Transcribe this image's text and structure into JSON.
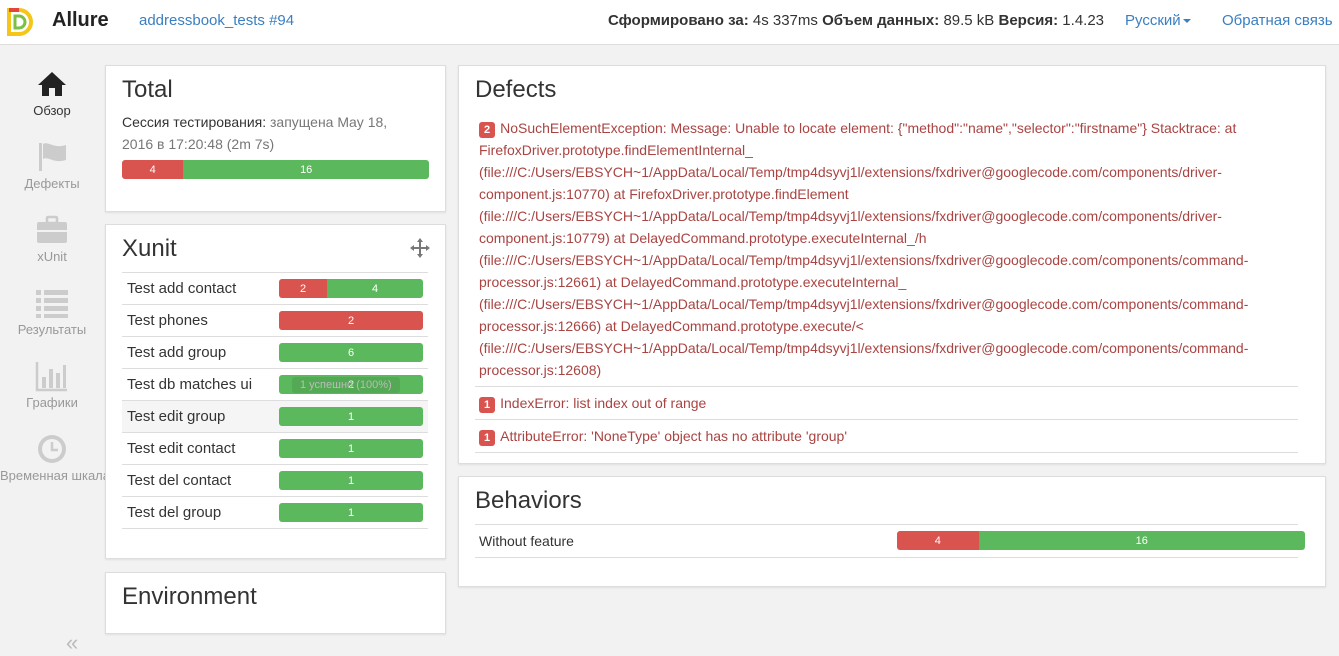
{
  "header": {
    "brand": "Allure",
    "breadcrumb": "addressbook_tests #94",
    "generated_label": "Сформировано за:",
    "generated_value": " 4s 337ms ",
    "size_label": "Объем данных:",
    "size_value": " 89.5 kB ",
    "version_label": "Версия:",
    "version_value": " 1.4.23",
    "language": "Русский",
    "feedback": "Обратная связь"
  },
  "sidebar": {
    "items": [
      {
        "label": "Обзор",
        "icon": "home-icon"
      },
      {
        "label": "Дефекты",
        "icon": "flag-icon"
      },
      {
        "label": "xUnit",
        "icon": "briefcase-icon"
      },
      {
        "label": "Результаты",
        "icon": "list-icon"
      },
      {
        "label": "Графики",
        "icon": "bar-chart-icon"
      },
      {
        "label": "Временная шкала",
        "icon": "clock-icon"
      }
    ],
    "collapse": "«"
  },
  "total": {
    "title": "Total",
    "session_label": "Сессия тестирования:",
    "session_value": " запущена May 18, 2016 в 17:20:48 (2m 7s)",
    "failed": 4,
    "passed": 16
  },
  "xunit": {
    "title": "Xunit",
    "rows": [
      {
        "name": "Test add contact",
        "failed": 2,
        "passed": 4
      },
      {
        "name": "Test phones",
        "failed": 2,
        "passed": 0
      },
      {
        "name": "Test add group",
        "failed": 0,
        "passed": 6
      },
      {
        "name": "Test db matches ui",
        "failed": 0,
        "passed": 2
      },
      {
        "name": "Test edit group",
        "failed": 0,
        "passed": 1
      },
      {
        "name": "Test edit contact",
        "failed": 0,
        "passed": 1
      },
      {
        "name": "Test del contact",
        "failed": 0,
        "passed": 1
      },
      {
        "name": "Test del group",
        "failed": 0,
        "passed": 1
      }
    ],
    "tooltip": "1 успешно (100%)"
  },
  "environment": {
    "title": "Environment"
  },
  "defects": {
    "title": "Defects",
    "items": [
      {
        "count": "2",
        "text": "NoSuchElementException: Message: Unable to locate element: {\"method\":\"name\",\"selector\":\"firstname\"} Stacktrace: at FirefoxDriver.prototype.findElementInternal_ (file:///C:/Users/EBSYCH~1/AppData/Local/Temp/tmp4dsyvj1l/extensions/fxdriver@googlecode.com/components/driver-component.js:10770) at FirefoxDriver.prototype.findElement (file:///C:/Users/EBSYCH~1/AppData/Local/Temp/tmp4dsyvj1l/extensions/fxdriver@googlecode.com/components/driver-component.js:10779) at DelayedCommand.prototype.executeInternal_/h (file:///C:/Users/EBSYCH~1/AppData/Local/Temp/tmp4dsyvj1l/extensions/fxdriver@googlecode.com/components/command-processor.js:12661) at DelayedCommand.prototype.executeInternal_ (file:///C:/Users/EBSYCH~1/AppData/Local/Temp/tmp4dsyvj1l/extensions/fxdriver@googlecode.com/components/command-processor.js:12666) at DelayedCommand.prototype.execute/< (file:///C:/Users/EBSYCH~1/AppData/Local/Temp/tmp4dsyvj1l/extensions/fxdriver@googlecode.com/components/command-processor.js:12608)"
      },
      {
        "count": "1",
        "text": "IndexError: list index out of range"
      },
      {
        "count": "1",
        "text": "AttributeError: 'NoneType' object has no attribute 'group'"
      }
    ]
  },
  "behaviors": {
    "title": "Behaviors",
    "rows": [
      {
        "name": "Without feature",
        "failed": 4,
        "passed": 16
      }
    ]
  },
  "colors": {
    "failed": "#d9534f",
    "passed": "#5cb85c",
    "link": "#3a7fc1",
    "defect_text": "#a94442"
  }
}
